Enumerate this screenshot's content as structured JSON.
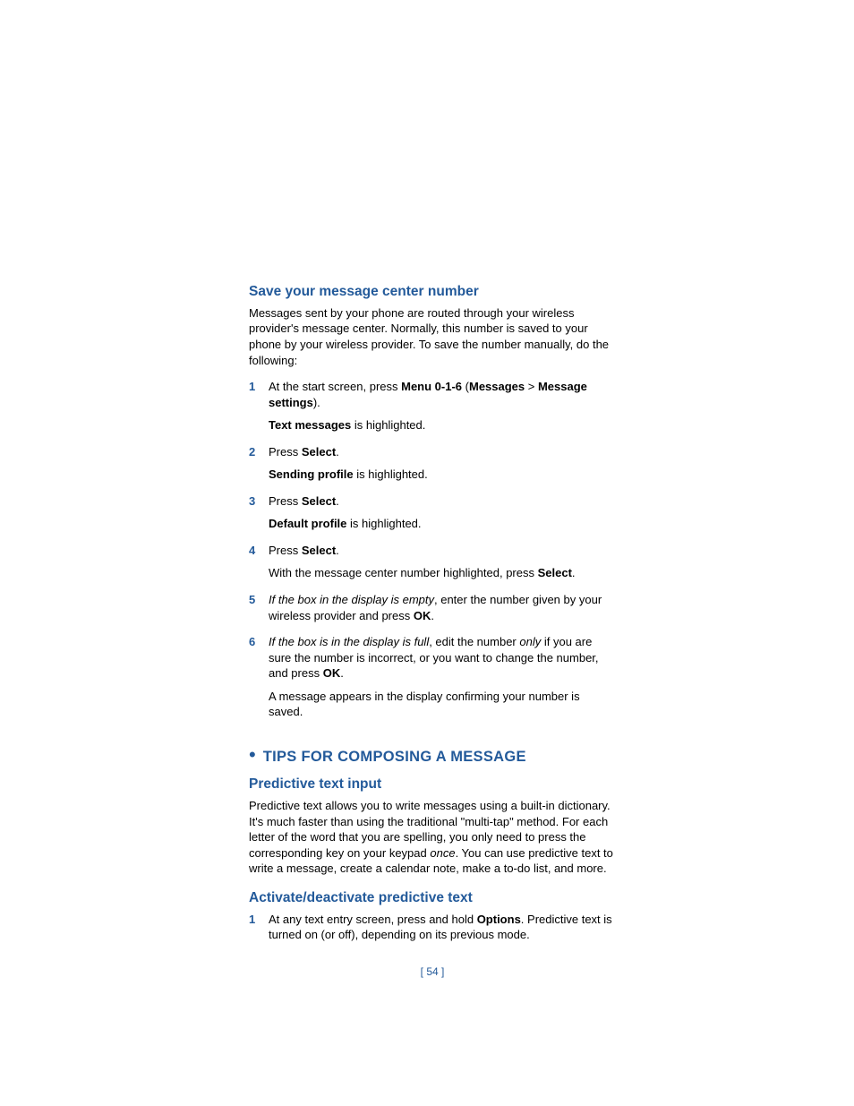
{
  "section1_title": "Save your message center number",
  "section1_para": "Messages sent by your phone are routed through your wireless provider's message center. Normally, this number is saved to your phone by your wireless provider. To save the number manually, do the following:",
  "step1": {
    "num": "1",
    "l1_a": "At the start screen, press ",
    "l1_b": "Menu 0-1-6",
    "l1_c": " (",
    "l1_d": "Messages",
    "l1_e": " > ",
    "l1_f": "Message settings",
    "l1_g": ").",
    "l2_a": "Text messages",
    "l2_b": " is highlighted."
  },
  "step2": {
    "num": "2",
    "l1_a": "Press ",
    "l1_b": "Select",
    "l1_c": ".",
    "l2_a": "Sending profile",
    "l2_b": " is highlighted."
  },
  "step3": {
    "num": "3",
    "l1_a": "Press ",
    "l1_b": "Select",
    "l1_c": ".",
    "l2_a": "Default profile",
    "l2_b": " is highlighted."
  },
  "step4": {
    "num": "4",
    "l1_a": "Press ",
    "l1_b": "Select",
    "l1_c": ".",
    "l2_a": "With the message center number highlighted, press ",
    "l2_b": "Select",
    "l2_c": "."
  },
  "step5": {
    "num": "5",
    "l1_a": "If the box in the display is empty",
    "l1_b": ", enter the number given by your wireless provider and press ",
    "l1_c": "OK",
    "l1_d": "."
  },
  "step6": {
    "num": "6",
    "l1_a": "If the box is in the display is full",
    "l1_b": ", edit the number ",
    "l1_c": "only",
    "l1_d": " if you are sure the number is incorrect, or you want to change the number, and press ",
    "l1_e": "OK",
    "l1_f": ".",
    "l2": "A message appears in the display confirming your number is saved."
  },
  "bullet": "•",
  "h1": "TIPS FOR COMPOSING A MESSAGE",
  "section2_title": "Predictive text input",
  "section2_para_a": "Predictive text allows you to write messages using a built-in dictionary. It's much faster than using the traditional \"multi-tap\" method. For each letter of the word that you are spelling, you only need to press the corresponding key on your keypad ",
  "section2_para_b": "once",
  "section2_para_c": ". You can use predictive text to write a message, create a calendar note, make a to-do list, and more.",
  "section3_title": "Activate/deactivate predictive text",
  "step7": {
    "num": "1",
    "l1_a": "At any text entry screen, press and hold ",
    "l1_b": "Options",
    "l1_c": ". Predictive text is turned on (or off), depending on its previous mode."
  },
  "page_number": "[ 54 ]"
}
